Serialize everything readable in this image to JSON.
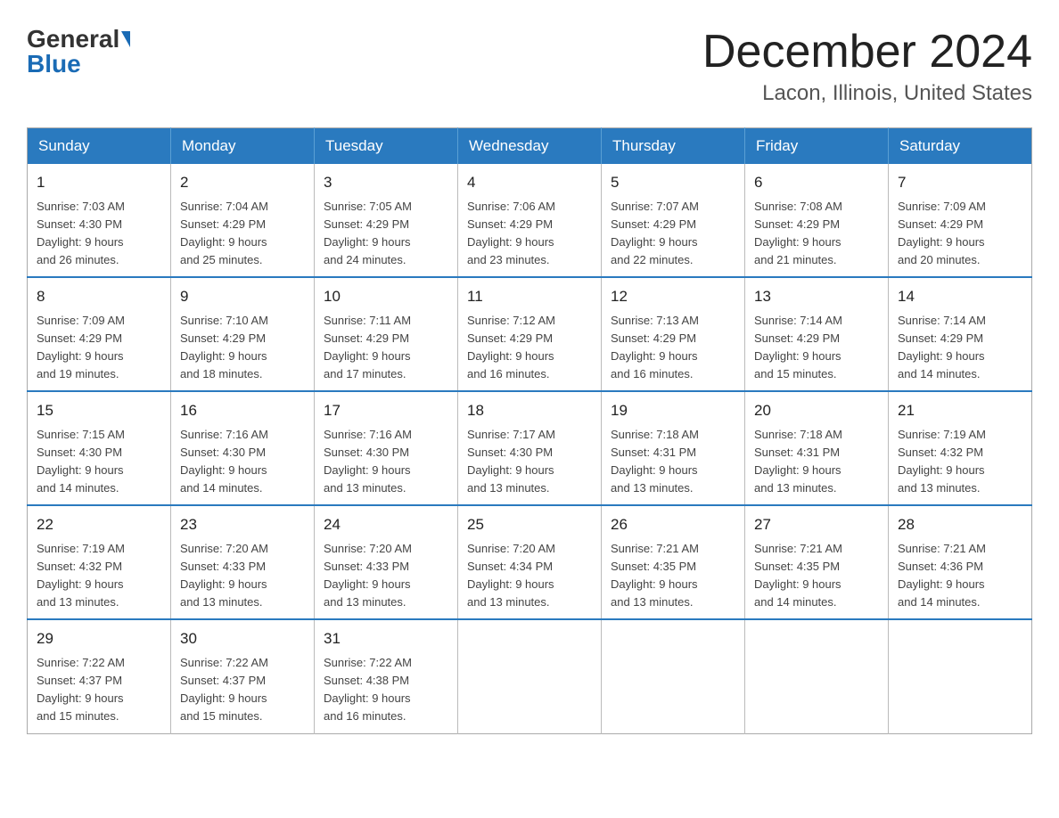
{
  "logo": {
    "general": "General",
    "blue": "Blue"
  },
  "title": "December 2024",
  "subtitle": "Lacon, Illinois, United States",
  "days_of_week": [
    "Sunday",
    "Monday",
    "Tuesday",
    "Wednesday",
    "Thursday",
    "Friday",
    "Saturday"
  ],
  "weeks": [
    [
      {
        "day": "1",
        "sunrise": "7:03 AM",
        "sunset": "4:30 PM",
        "daylight": "9 hours and 26 minutes."
      },
      {
        "day": "2",
        "sunrise": "7:04 AM",
        "sunset": "4:29 PM",
        "daylight": "9 hours and 25 minutes."
      },
      {
        "day": "3",
        "sunrise": "7:05 AM",
        "sunset": "4:29 PM",
        "daylight": "9 hours and 24 minutes."
      },
      {
        "day": "4",
        "sunrise": "7:06 AM",
        "sunset": "4:29 PM",
        "daylight": "9 hours and 23 minutes."
      },
      {
        "day": "5",
        "sunrise": "7:07 AM",
        "sunset": "4:29 PM",
        "daylight": "9 hours and 22 minutes."
      },
      {
        "day": "6",
        "sunrise": "7:08 AM",
        "sunset": "4:29 PM",
        "daylight": "9 hours and 21 minutes."
      },
      {
        "day": "7",
        "sunrise": "7:09 AM",
        "sunset": "4:29 PM",
        "daylight": "9 hours and 20 minutes."
      }
    ],
    [
      {
        "day": "8",
        "sunrise": "7:09 AM",
        "sunset": "4:29 PM",
        "daylight": "9 hours and 19 minutes."
      },
      {
        "day": "9",
        "sunrise": "7:10 AM",
        "sunset": "4:29 PM",
        "daylight": "9 hours and 18 minutes."
      },
      {
        "day": "10",
        "sunrise": "7:11 AM",
        "sunset": "4:29 PM",
        "daylight": "9 hours and 17 minutes."
      },
      {
        "day": "11",
        "sunrise": "7:12 AM",
        "sunset": "4:29 PM",
        "daylight": "9 hours and 16 minutes."
      },
      {
        "day": "12",
        "sunrise": "7:13 AM",
        "sunset": "4:29 PM",
        "daylight": "9 hours and 16 minutes."
      },
      {
        "day": "13",
        "sunrise": "7:14 AM",
        "sunset": "4:29 PM",
        "daylight": "9 hours and 15 minutes."
      },
      {
        "day": "14",
        "sunrise": "7:14 AM",
        "sunset": "4:29 PM",
        "daylight": "9 hours and 14 minutes."
      }
    ],
    [
      {
        "day": "15",
        "sunrise": "7:15 AM",
        "sunset": "4:30 PM",
        "daylight": "9 hours and 14 minutes."
      },
      {
        "day": "16",
        "sunrise": "7:16 AM",
        "sunset": "4:30 PM",
        "daylight": "9 hours and 14 minutes."
      },
      {
        "day": "17",
        "sunrise": "7:16 AM",
        "sunset": "4:30 PM",
        "daylight": "9 hours and 13 minutes."
      },
      {
        "day": "18",
        "sunrise": "7:17 AM",
        "sunset": "4:30 PM",
        "daylight": "9 hours and 13 minutes."
      },
      {
        "day": "19",
        "sunrise": "7:18 AM",
        "sunset": "4:31 PM",
        "daylight": "9 hours and 13 minutes."
      },
      {
        "day": "20",
        "sunrise": "7:18 AM",
        "sunset": "4:31 PM",
        "daylight": "9 hours and 13 minutes."
      },
      {
        "day": "21",
        "sunrise": "7:19 AM",
        "sunset": "4:32 PM",
        "daylight": "9 hours and 13 minutes."
      }
    ],
    [
      {
        "day": "22",
        "sunrise": "7:19 AM",
        "sunset": "4:32 PM",
        "daylight": "9 hours and 13 minutes."
      },
      {
        "day": "23",
        "sunrise": "7:20 AM",
        "sunset": "4:33 PM",
        "daylight": "9 hours and 13 minutes."
      },
      {
        "day": "24",
        "sunrise": "7:20 AM",
        "sunset": "4:33 PM",
        "daylight": "9 hours and 13 minutes."
      },
      {
        "day": "25",
        "sunrise": "7:20 AM",
        "sunset": "4:34 PM",
        "daylight": "9 hours and 13 minutes."
      },
      {
        "day": "26",
        "sunrise": "7:21 AM",
        "sunset": "4:35 PM",
        "daylight": "9 hours and 13 minutes."
      },
      {
        "day": "27",
        "sunrise": "7:21 AM",
        "sunset": "4:35 PM",
        "daylight": "9 hours and 14 minutes."
      },
      {
        "day": "28",
        "sunrise": "7:21 AM",
        "sunset": "4:36 PM",
        "daylight": "9 hours and 14 minutes."
      }
    ],
    [
      {
        "day": "29",
        "sunrise": "7:22 AM",
        "sunset": "4:37 PM",
        "daylight": "9 hours and 15 minutes."
      },
      {
        "day": "30",
        "sunrise": "7:22 AM",
        "sunset": "4:37 PM",
        "daylight": "9 hours and 15 minutes."
      },
      {
        "day": "31",
        "sunrise": "7:22 AM",
        "sunset": "4:38 PM",
        "daylight": "9 hours and 16 minutes."
      },
      null,
      null,
      null,
      null
    ]
  ],
  "labels": {
    "sunrise": "Sunrise:",
    "sunset": "Sunset:",
    "daylight": "Daylight:"
  }
}
